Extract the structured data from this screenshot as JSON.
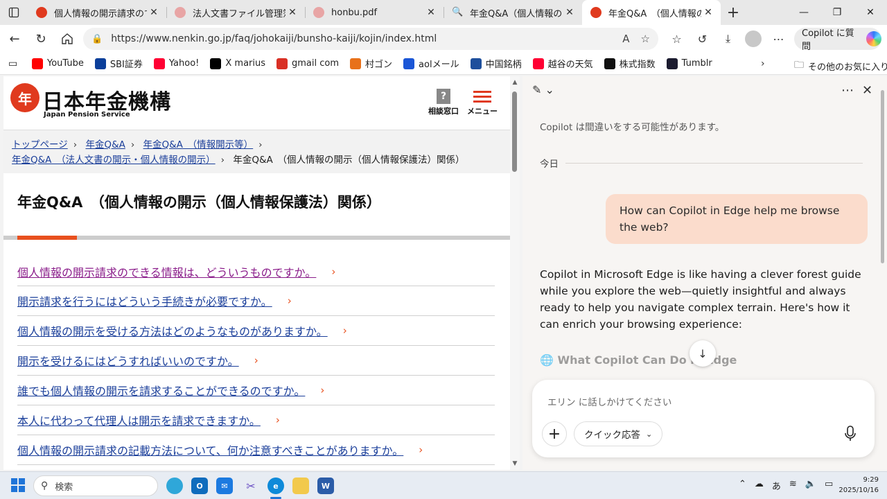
{
  "tabs": [
    {
      "title": "個人情報の開示請求ので"
    },
    {
      "title": "法人文書ファイル管理簿（"
    },
    {
      "title": "honbu.pdf"
    },
    {
      "title": "年金Q&A（個人情報の開示"
    },
    {
      "title": "年金Q&A　（個人情報の"
    }
  ],
  "address": {
    "url": "https://www.nenkin.go.jp/faq/johokaiji/bunsho-kaiji/kojin/index.html"
  },
  "copilot_button": "Copilot に質問",
  "favorites": [
    {
      "label": "YouTube",
      "icon": "youtube-icon",
      "color": "#ff0000"
    },
    {
      "label": "SBI証券",
      "icon": "sbi-icon",
      "color": "#0b3f9a"
    },
    {
      "label": "Yahoo!",
      "icon": "yahoo-icon",
      "color": "#ff0033"
    },
    {
      "label": "X marius",
      "icon": "x-icon",
      "color": "#000000"
    },
    {
      "label": "gmail com",
      "icon": "gmail-icon",
      "color": "#d93025"
    },
    {
      "label": "村ゴン",
      "icon": "bookmark-icon",
      "color": "#e8711a"
    },
    {
      "label": "aolメール",
      "icon": "aol-icon",
      "color": "#1b56d6"
    },
    {
      "label": "中国銘柄",
      "icon": "chart-icon",
      "color": "#1e4f9c"
    },
    {
      "label": "越谷の天気",
      "icon": "yahoo-icon",
      "color": "#ff0033"
    },
    {
      "label": "株式指数",
      "icon": "b-icon",
      "color": "#111111"
    },
    {
      "label": "Tumblr",
      "icon": "tumblr-icon",
      "color": "#1b1b2f"
    }
  ],
  "favorites_other": "その他のお気に入り",
  "site": {
    "logo_mark": "年",
    "logo_text": "日本年金機構",
    "logo_sub": "Japan Pension Service",
    "contact_label": "相談窓口",
    "menu_label": "メニュー",
    "breadcrumb": [
      {
        "label": "トップページ",
        "link": true
      },
      {
        "label": "年金Q&A",
        "link": true
      },
      {
        "label": "年金Q&A　（情報開示等）",
        "link": true
      },
      {
        "label": "年金Q&A　（法人文書の開示・個人情報の開示）",
        "link": true
      },
      {
        "label": "年金Q&A　（個人情報の開示（個人情報保護法）関係）",
        "link": false
      }
    ],
    "page_title": "年金Q&A　（個人情報の開示（個人情報保護法）関係）",
    "faq": [
      {
        "text": "個人情報の開示請求のできる情報は、どういうものですか。",
        "visited": true
      },
      {
        "text": "開示請求を行うにはどういう手続きが必要ですか。",
        "visited": false
      },
      {
        "text": "個人情報の開示を受ける方法はどのようなものがありますか。",
        "visited": false
      },
      {
        "text": "開示を受けるにはどうすればいいのですか。",
        "visited": false
      },
      {
        "text": "誰でも個人情報の開示を請求することができるのですか。",
        "visited": false
      },
      {
        "text": "本人に代わって代理人は開示を請求できますか。",
        "visited": false
      },
      {
        "text": "個人情報の開示請求の記載方法について、何か注意すべきことがありますか。",
        "visited": false
      }
    ],
    "accent_color": "#e8501e",
    "link_color": "#1a3e9a"
  },
  "copilot": {
    "disclaimer": "Copilot は間違いをする可能性があります。",
    "today": "今日",
    "user_message": "How can Copilot in Edge help me browse the web?",
    "reply": "Copilot in Microsoft Edge is like having a clever forest guide while you explore the web—quietly insightful and always ready to help you navigate complex terrain. Here's how it can enrich your browsing experience:",
    "reply_heading": "What Copilot Can Do in Edge",
    "input_placeholder": "エリン に話しかけてください",
    "mode_label": "クイック応答"
  },
  "taskbar": {
    "search_placeholder": "検索",
    "ime": "あ",
    "time": "9:29",
    "date": "2025/10/16"
  }
}
